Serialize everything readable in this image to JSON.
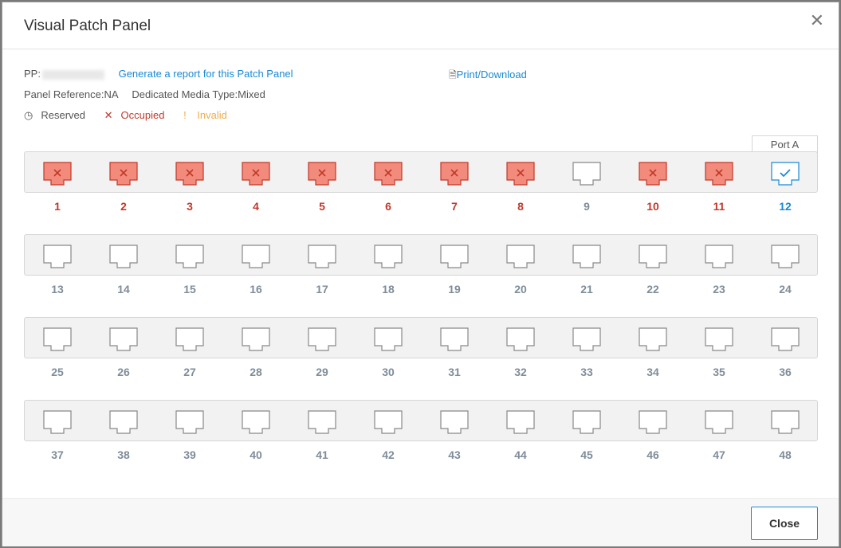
{
  "modal": {
    "title": "Visual Patch Panel",
    "close_icon": "close-icon"
  },
  "info": {
    "pp_label": "PP:",
    "report_link": "Generate a report for this Patch Panel",
    "print_link": "Print/Download",
    "panel_reference": "Panel Reference:NA",
    "media_type": "Dedicated Media Type:Mixed"
  },
  "legend": {
    "reserved": "Reserved",
    "occupied": "Occupied",
    "invalid": "Invalid"
  },
  "port_tab": "Port A",
  "ports": [
    {
      "num": "1",
      "state": "occupied"
    },
    {
      "num": "2",
      "state": "occupied"
    },
    {
      "num": "3",
      "state": "occupied"
    },
    {
      "num": "4",
      "state": "occupied"
    },
    {
      "num": "5",
      "state": "occupied"
    },
    {
      "num": "6",
      "state": "occupied"
    },
    {
      "num": "7",
      "state": "occupied"
    },
    {
      "num": "8",
      "state": "occupied"
    },
    {
      "num": "9",
      "state": "free"
    },
    {
      "num": "10",
      "state": "occupied"
    },
    {
      "num": "11",
      "state": "occupied"
    },
    {
      "num": "12",
      "state": "selected"
    },
    {
      "num": "13",
      "state": "free"
    },
    {
      "num": "14",
      "state": "free"
    },
    {
      "num": "15",
      "state": "free"
    },
    {
      "num": "16",
      "state": "free"
    },
    {
      "num": "17",
      "state": "free"
    },
    {
      "num": "18",
      "state": "free"
    },
    {
      "num": "19",
      "state": "free"
    },
    {
      "num": "20",
      "state": "free"
    },
    {
      "num": "21",
      "state": "free"
    },
    {
      "num": "22",
      "state": "free"
    },
    {
      "num": "23",
      "state": "free"
    },
    {
      "num": "24",
      "state": "free"
    },
    {
      "num": "25",
      "state": "free"
    },
    {
      "num": "26",
      "state": "free"
    },
    {
      "num": "27",
      "state": "free"
    },
    {
      "num": "28",
      "state": "free"
    },
    {
      "num": "29",
      "state": "free"
    },
    {
      "num": "30",
      "state": "free"
    },
    {
      "num": "31",
      "state": "free"
    },
    {
      "num": "32",
      "state": "free"
    },
    {
      "num": "33",
      "state": "free"
    },
    {
      "num": "34",
      "state": "free"
    },
    {
      "num": "35",
      "state": "free"
    },
    {
      "num": "36",
      "state": "free"
    },
    {
      "num": "37",
      "state": "free"
    },
    {
      "num": "38",
      "state": "free"
    },
    {
      "num": "39",
      "state": "free"
    },
    {
      "num": "40",
      "state": "free"
    },
    {
      "num": "41",
      "state": "free"
    },
    {
      "num": "42",
      "state": "free"
    },
    {
      "num": "43",
      "state": "free"
    },
    {
      "num": "44",
      "state": "free"
    },
    {
      "num": "45",
      "state": "free"
    },
    {
      "num": "46",
      "state": "free"
    },
    {
      "num": "47",
      "state": "free"
    },
    {
      "num": "48",
      "state": "free"
    }
  ],
  "colors": {
    "occupied_fill": "#f28b7b",
    "occupied_stroke": "#c0392b",
    "selected_stroke": "#1a8ad4",
    "free_stroke": "#888888"
  },
  "footer": {
    "close_label": "Close"
  }
}
